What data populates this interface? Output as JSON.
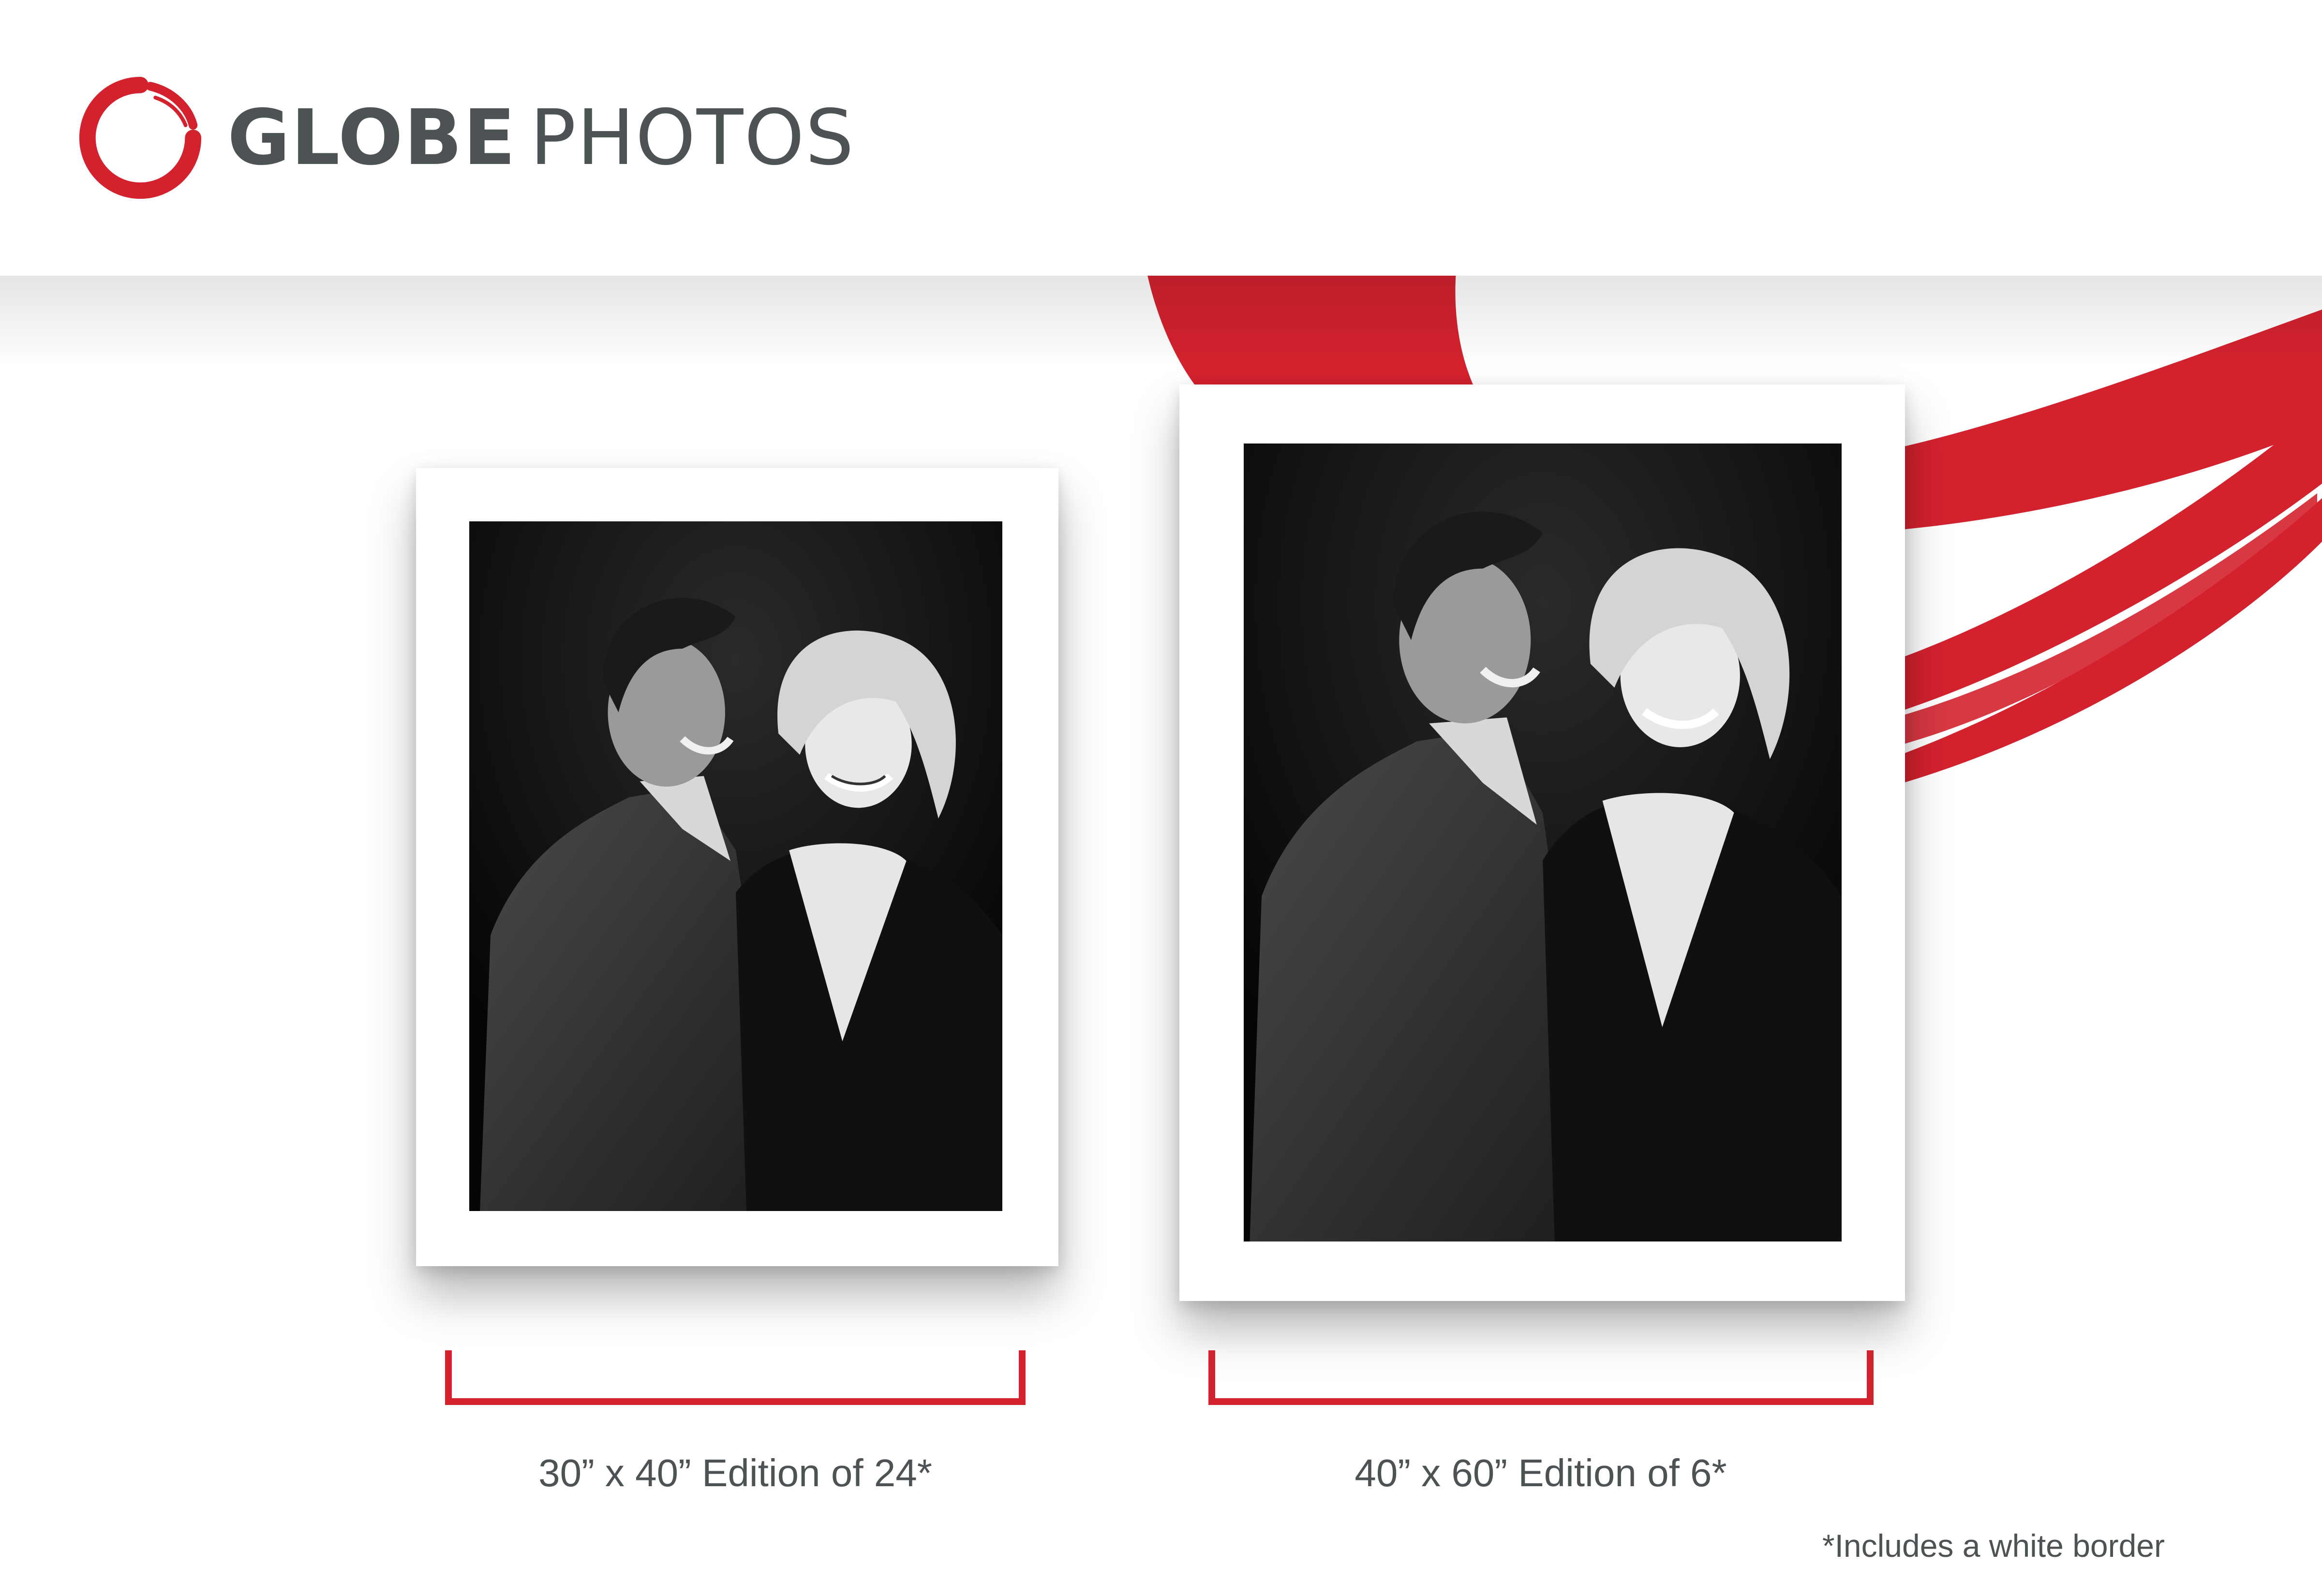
{
  "brand": {
    "name_bold": "GLOBE",
    "name_light": "PHOTOS",
    "logo_icon": "red-brush-circle-icon",
    "accent_color": "#d3222e",
    "text_color": "#4d5355"
  },
  "prints": [
    {
      "caption": "30” x 40” Edition of 24*",
      "image": "black-and-white-portrait-couple"
    },
    {
      "caption": "40” x 60” Edition of 6*",
      "image": "black-and-white-portrait-couple"
    }
  ],
  "footnote": "*Includes a white border"
}
